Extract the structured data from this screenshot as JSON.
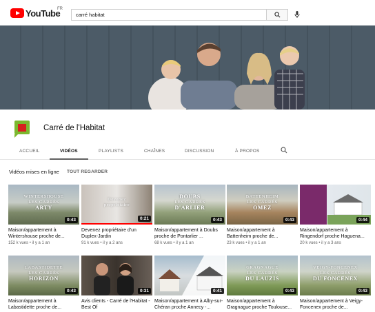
{
  "header": {
    "logo_text": "YouTube",
    "country_code": "FR",
    "search_value": "carré habitat"
  },
  "channel": {
    "name": "Carré de l'Habitat"
  },
  "tabs": [
    {
      "label": "ACCUEIL"
    },
    {
      "label": "VIDÉOS"
    },
    {
      "label": "PLAYLISTS"
    },
    {
      "label": "CHAÎNES"
    },
    {
      "label": "DISCUSSION"
    },
    {
      "label": "À PROPOS"
    }
  ],
  "section": {
    "title": "Vidéos mises en ligne",
    "play_all": "TOUT REGARDER"
  },
  "videos": [
    {
      "title": "Maison/appartement à Wintershouse proche de...",
      "views": "152 k vues",
      "age": "il y a 1 an",
      "duration": "0:43",
      "thumb_line1": "WINTERSHOUSE",
      "thumb_line2": "LES CARRÉS",
      "thumb_line3": "ARTY"
    },
    {
      "title": "Devenez propriétaire d'un Duplex-Jardin",
      "views": "91 k vues",
      "age": "il y a 2 ans",
      "duration": "0:21",
      "thumb_line1": "Devenez",
      "thumb_line2": "propriétaire",
      "thumb_line3": ""
    },
    {
      "title": "Maison/appartement à Doubs proche de Pontarlier ...",
      "views": "68 k vues",
      "age": "il y a 1 an",
      "duration": "0:43",
      "thumb_line1": "DOUBS",
      "thumb_line2": "LES CARRÉS",
      "thumb_line3": "D'ARLIER"
    },
    {
      "title": "Maison/appartement à Battenheim proche de...",
      "views": "23 k vues",
      "age": "il y a 1 an",
      "duration": "0:43",
      "thumb_line1": "BATTENHEIM",
      "thumb_line2": "LES CARRÉS",
      "thumb_line3": "OMEZ"
    },
    {
      "title": "Maison/appartement à Ringendorf proche Haguena...",
      "views": "20 k vues",
      "age": "il y a 3 ans",
      "duration": "0:44",
      "thumb_line1": "",
      "thumb_line2": "",
      "thumb_line3": ""
    },
    {
      "title": "Maison/appartement à Labastidette proche de...",
      "views": "",
      "age": "",
      "duration": "0:43",
      "thumb_line1": "LABASTIDETTE",
      "thumb_line2": "LES CARRÉS",
      "thumb_line3": "HORIZON"
    },
    {
      "title": "Avis clients - Carré de l'Habitat - Best Of",
      "views": "",
      "age": "",
      "duration": "0:31",
      "thumb_line1": "",
      "thumb_line2": "",
      "thumb_line3": ""
    },
    {
      "title": "Maison/appartement à Alby-sur-Chéran proche Annecy -...",
      "views": "",
      "age": "",
      "duration": "0:41",
      "thumb_line1": "",
      "thumb_line2": "",
      "thumb_line3": ""
    },
    {
      "title": "Maison/appartement à Gragnague proche Toulouse...",
      "views": "",
      "age": "",
      "duration": "0:43",
      "thumb_line1": "GRAGNAGUE",
      "thumb_line2": "LES CARRÉS",
      "thumb_line3": "DU LAUZIS"
    },
    {
      "title": "Maison/appartement à Veigy-Foncenex proche de...",
      "views": "",
      "age": "",
      "duration": "0:43",
      "thumb_line1": "VEIGY-FONCENEX",
      "thumb_line2": "LES CARRÉS",
      "thumb_line3": "DU FONCENEX"
    }
  ],
  "meta_separator": "•",
  "brand_colors": {
    "youtube_red": "#ff0000",
    "channel_green": "#7cb82f",
    "channel_red": "#d6211e"
  },
  "icons": [
    "search-icon",
    "mic-icon",
    "tab-search-icon"
  ]
}
